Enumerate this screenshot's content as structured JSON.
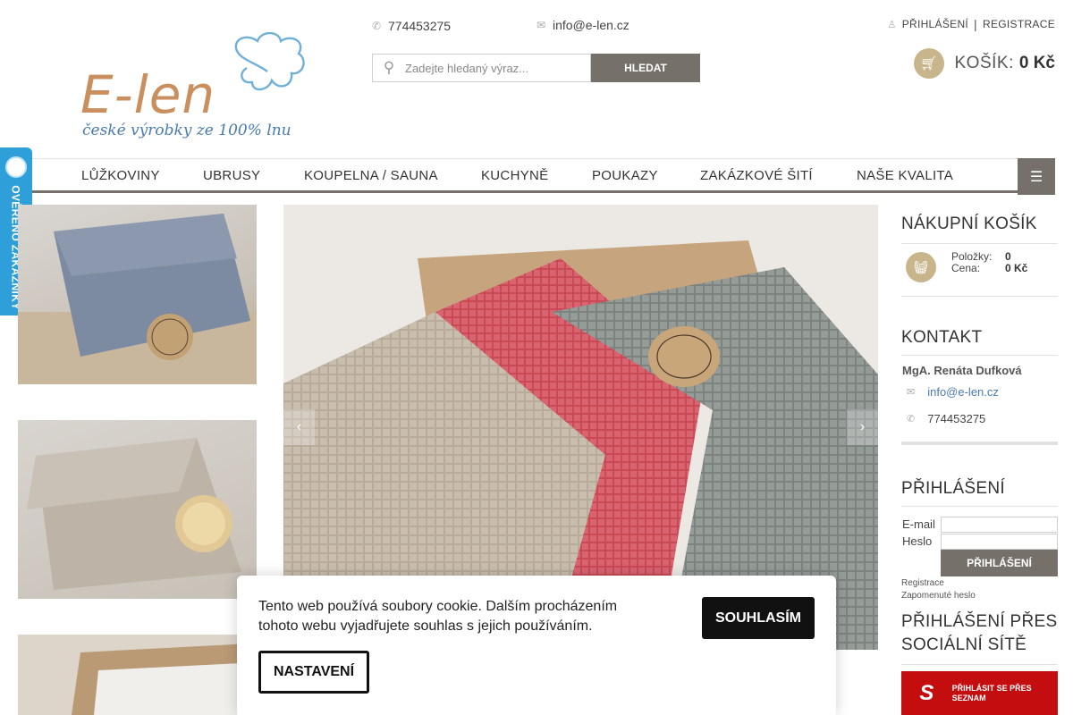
{
  "brand": {
    "logo_text": "E-len",
    "logo_subtitle": "české výrobky ze 100% lnu"
  },
  "header": {
    "phone": "774453275",
    "email": "info@e-len.cz",
    "search_placeholder": "Zadejte hledaný výraz...",
    "search_button": "HLEDAT",
    "login_link": "PŘIHLÁŠENÍ",
    "separator": "|",
    "register_link": "REGISTRACE",
    "cart_label": "KOŠÍK:",
    "cart_amount": "0 Kč"
  },
  "nav": {
    "items": [
      "LŮŽKOVINY",
      "UBRUSY",
      "KOUPELNA / SAUNA",
      "KUCHYNĚ",
      "POUKAZY",
      "ZAKÁZKOVÉ ŠITÍ",
      "NAŠE KVALITA"
    ]
  },
  "badge": {
    "text": "OVĚŘENO ZÁKAZNÍKY"
  },
  "sidebar": {
    "cart_title": "NÁKUPNÍ KOŠÍK",
    "items_label": "Položky:",
    "items_value": "0",
    "price_label": "Cena:",
    "price_value": "0 Kč",
    "contact_title": "KONTAKT",
    "contact_name": "MgA. Renáta Dufková",
    "contact_email": "info@e-len.cz",
    "contact_phone": "774453275",
    "login_title": "PŘIHLÁŠENÍ",
    "email_label": "E-mail",
    "password_label": "Heslo",
    "login_button": "PŘIHLÁŠENÍ",
    "register_link": "Registrace",
    "forgot_link": "Zapomenuté heslo",
    "social_title": "PŘIHLÁŠENÍ PŘES SOCIÁLNÍ SÍTĚ",
    "seznam_button": "PŘIHLÁSIT SE PŘES SEZNAM"
  },
  "cookie": {
    "text": "Tento web používá soubory cookie. Dalším procházením tohoto webu vyjadřujete souhlas s jejich používáním.",
    "accept": "SOUHLASÍM",
    "settings": "NASTAVENÍ"
  },
  "colors": {
    "brand_gold": "#c9b58c",
    "nav_gray": "#76706a",
    "badge_blue": "#2e9fd8",
    "seznam_red": "#c40d0f"
  }
}
